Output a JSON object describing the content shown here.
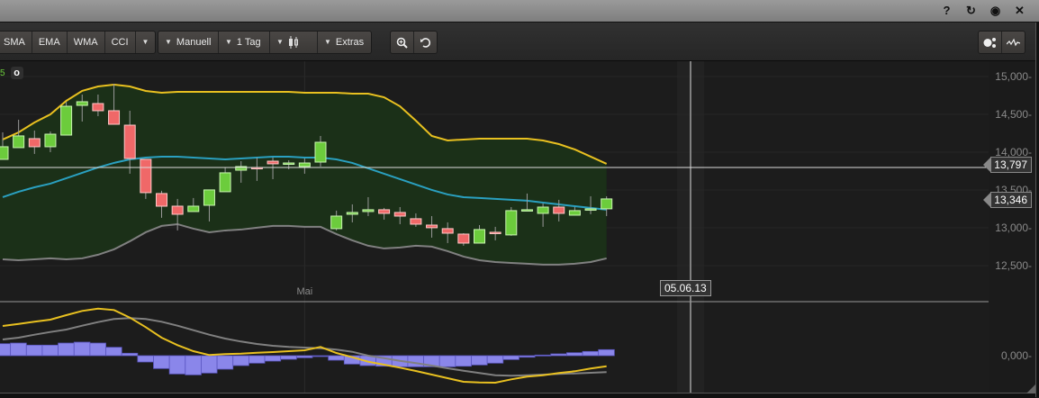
{
  "window": {
    "icons": [
      {
        "name": "help-icon",
        "glyph": "?"
      },
      {
        "name": "reset-icon",
        "glyph": "↻"
      },
      {
        "name": "record-icon",
        "glyph": "◉"
      },
      {
        "name": "close-icon",
        "glyph": "✕"
      }
    ]
  },
  "toolbar": {
    "indicators": [
      "SMA",
      "EMA",
      "WMA",
      "CCI"
    ],
    "more_caret": "▾",
    "drawing_mode": "Manuell",
    "interval": "1 Tag",
    "extras": "Extras",
    "chart_type_icon": "candlestick-icon",
    "zoom_icon": "zoom-icon",
    "undo_icon": "undo-icon",
    "right_icons": [
      "indicator-settings-icon",
      "sparkline-icon"
    ]
  },
  "legend": {
    "period": "5",
    "toggle": "o"
  },
  "crosshair": {
    "price_label": "13,797",
    "date_label": "05.06.13"
  },
  "last_price_label": "13,346",
  "colors": {
    "bull": "#6ccc3c",
    "bear": "#f06868",
    "upper": "#e8c020",
    "middle": "#2aa0c0",
    "lower": "#808080",
    "band_fill": "#1b3018",
    "histogram": "#8a86ea",
    "macd": "#e8c020",
    "signal": "#808080"
  },
  "chart_data": [
    {
      "type": "candlestick",
      "title": "",
      "y_ticks": [
        {
          "value": 15000,
          "label": "15,000-"
        },
        {
          "value": 14500,
          "label": "14,500-"
        },
        {
          "value": 14000,
          "label": "14,000-"
        },
        {
          "value": 13500,
          "label": "13,500-"
        },
        {
          "value": 13000,
          "label": "13,000-"
        },
        {
          "value": 12500,
          "label": "12,500-"
        }
      ],
      "x_labels": [
        {
          "index": 19,
          "label": "Mai"
        }
      ],
      "ylim": [
        12400,
        15100
      ],
      "ohlc": [
        [
          13905,
          14262,
          13905,
          14072
        ],
        [
          14060,
          14429,
          14060,
          14215
        ],
        [
          14179,
          14286,
          13977,
          14072
        ],
        [
          14072,
          14274,
          14000,
          14238
        ],
        [
          14226,
          14667,
          14226,
          14607
        ],
        [
          14619,
          14762,
          14405,
          14667
        ],
        [
          14643,
          14762,
          14476,
          14548
        ],
        [
          14548,
          14905,
          14369,
          14369
        ],
        [
          14357,
          14548,
          13715,
          13917
        ],
        [
          13905,
          13905,
          13382,
          13465
        ],
        [
          13453,
          13489,
          13132,
          13286
        ],
        [
          13286,
          13382,
          12965,
          13179
        ],
        [
          13215,
          13394,
          13215,
          13286
        ],
        [
          13298,
          13501,
          13084,
          13501
        ],
        [
          13477,
          13798,
          13477,
          13727
        ],
        [
          13762,
          13881,
          13596,
          13810
        ],
        [
          13798,
          13929,
          13620,
          13786
        ],
        [
          13881,
          13929,
          13643,
          13846
        ],
        [
          13846,
          13893,
          13774,
          13857
        ],
        [
          13810,
          13917,
          13715,
          13857
        ],
        [
          13869,
          14215,
          13810,
          14131
        ],
        [
          12989,
          13227,
          12965,
          13155
        ],
        [
          13179,
          13310,
          13072,
          13203
        ],
        [
          13215,
          13405,
          13155,
          13239
        ],
        [
          13239,
          13263,
          13108,
          13191
        ],
        [
          13203,
          13274,
          13048,
          13155
        ],
        [
          13120,
          13191,
          13013,
          13048
        ],
        [
          13036,
          13155,
          12870,
          13001
        ],
        [
          12989,
          13072,
          12798,
          12929
        ],
        [
          12917,
          12929,
          12763,
          12798
        ],
        [
          12798,
          13036,
          12798,
          12977
        ],
        [
          12941,
          13013,
          12834,
          12929
        ],
        [
          12906,
          13274,
          12894,
          13227
        ],
        [
          13227,
          13453,
          13227,
          13239
        ],
        [
          13191,
          13322,
          13013,
          13274
        ],
        [
          13274,
          13370,
          13084,
          13191
        ],
        [
          13167,
          13274,
          13167,
          13227
        ],
        [
          13239,
          13417,
          13179,
          13251
        ],
        [
          13251,
          13417,
          13155,
          13382
        ]
      ],
      "bollinger": {
        "upper": [
          14167,
          14262,
          14393,
          14500,
          14679,
          14810,
          14869,
          14893,
          14869,
          14810,
          14786,
          14798,
          14798,
          14798,
          14798,
          14798,
          14798,
          14798,
          14798,
          14786,
          14786,
          14786,
          14774,
          14774,
          14726,
          14607,
          14417,
          14215,
          14155,
          14167,
          14179,
          14179,
          14179,
          14179,
          14155,
          14107,
          14036,
          13941,
          13846
        ],
        "middle": [
          13405,
          13477,
          13536,
          13584,
          13655,
          13727,
          13798,
          13858,
          13905,
          13929,
          13941,
          13941,
          13929,
          13917,
          13905,
          13917,
          13929,
          13941,
          13941,
          13929,
          13929,
          13905,
          13858,
          13786,
          13715,
          13643,
          13572,
          13501,
          13441,
          13405,
          13394,
          13382,
          13370,
          13358,
          13334,
          13310,
          13286,
          13263,
          13239
        ],
        "lower": [
          12584,
          12572,
          12584,
          12596,
          12584,
          12596,
          12644,
          12715,
          12822,
          12941,
          13025,
          13048,
          12989,
          12941,
          12965,
          12977,
          13001,
          13025,
          13025,
          13013,
          13013,
          12917,
          12834,
          12763,
          12727,
          12739,
          12763,
          12751,
          12691,
          12620,
          12572,
          12548,
          12536,
          12525,
          12513,
          12513,
          12525,
          12548,
          12596
        ]
      },
      "crosshair_value": 13797,
      "last_value": 13346
    },
    {
      "type": "bar+line",
      "title": "MACD",
      "y_ticks": [
        {
          "value": 0,
          "label": "0,000-"
        }
      ],
      "histogram": [
        133,
        140,
        117,
        117,
        140,
        150,
        140,
        93,
        27,
        -70,
        -143,
        -203,
        -213,
        -193,
        -150,
        -110,
        -83,
        -60,
        -40,
        -23,
        -10,
        -50,
        -93,
        -110,
        -117,
        -123,
        -123,
        -123,
        -123,
        -117,
        -103,
        -83,
        -43,
        -17,
        7,
        20,
        33,
        47,
        67
      ],
      "macd": [
        330,
        353,
        377,
        400,
        450,
        497,
        523,
        507,
        423,
        317,
        200,
        117,
        50,
        7,
        17,
        23,
        33,
        40,
        50,
        60,
        97,
        30,
        -17,
        -67,
        -100,
        -133,
        -170,
        -210,
        -250,
        -290,
        -297,
        -300,
        -263,
        -233,
        -217,
        -193,
        -173,
        -143,
        -117
      ],
      "signal": [
        180,
        200,
        233,
        263,
        290,
        333,
        373,
        407,
        417,
        407,
        377,
        333,
        283,
        233,
        190,
        157,
        130,
        110,
        97,
        90,
        83,
        67,
        43,
        0,
        -27,
        -57,
        -83,
        -110,
        -140,
        -167,
        -193,
        -217,
        -223,
        -217,
        -210,
        -203,
        -197,
        -190,
        -183
      ]
    }
  ]
}
